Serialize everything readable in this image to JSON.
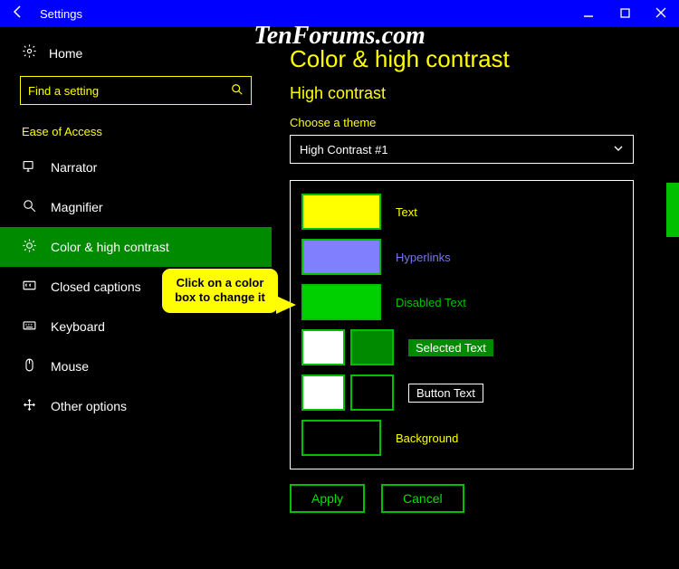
{
  "watermark": "TenForums.com",
  "window": {
    "title": "Settings"
  },
  "sidebar": {
    "home": "Home",
    "search_placeholder": "Find a setting",
    "section": "Ease of Access",
    "items": [
      {
        "icon": "narrator",
        "label": "Narrator"
      },
      {
        "icon": "magnifier",
        "label": "Magnifier"
      },
      {
        "icon": "contrast",
        "label": "Color & high contrast"
      },
      {
        "icon": "captions",
        "label": "Closed captions"
      },
      {
        "icon": "keyboard",
        "label": "Keyboard"
      },
      {
        "icon": "mouse",
        "label": "Mouse"
      },
      {
        "icon": "other",
        "label": "Other options"
      }
    ]
  },
  "main": {
    "title": "Color & high contrast",
    "subtitle": "High contrast",
    "theme_label": "Choose a theme",
    "theme_value": "High Contrast #1",
    "rows": {
      "text": {
        "label": "Text",
        "color": "#ffff00",
        "label_color": "#ffff00"
      },
      "hyperlinks": {
        "label": "Hyperlinks",
        "color": "#8080ff",
        "label_color": "#7878e8"
      },
      "disabled": {
        "label": "Disabled Text",
        "color": "#00d000",
        "label_color": "#00c000"
      },
      "selected": {
        "label": "Selected Text",
        "fg": "#ffffff",
        "bg": "#008a00",
        "chip_bg": "#008a00",
        "chip_fg": "#ffffff"
      },
      "button": {
        "label": "Button Text",
        "fg": "#ffffff",
        "bg": "#000000",
        "chip_border": "#ffffff",
        "chip_fg": "#ffffff"
      },
      "background": {
        "label": "Background",
        "color": "#000000",
        "label_color": "#ffff00"
      }
    },
    "apply": "Apply",
    "cancel": "Cancel"
  },
  "callout": "Click on a color box to change it"
}
